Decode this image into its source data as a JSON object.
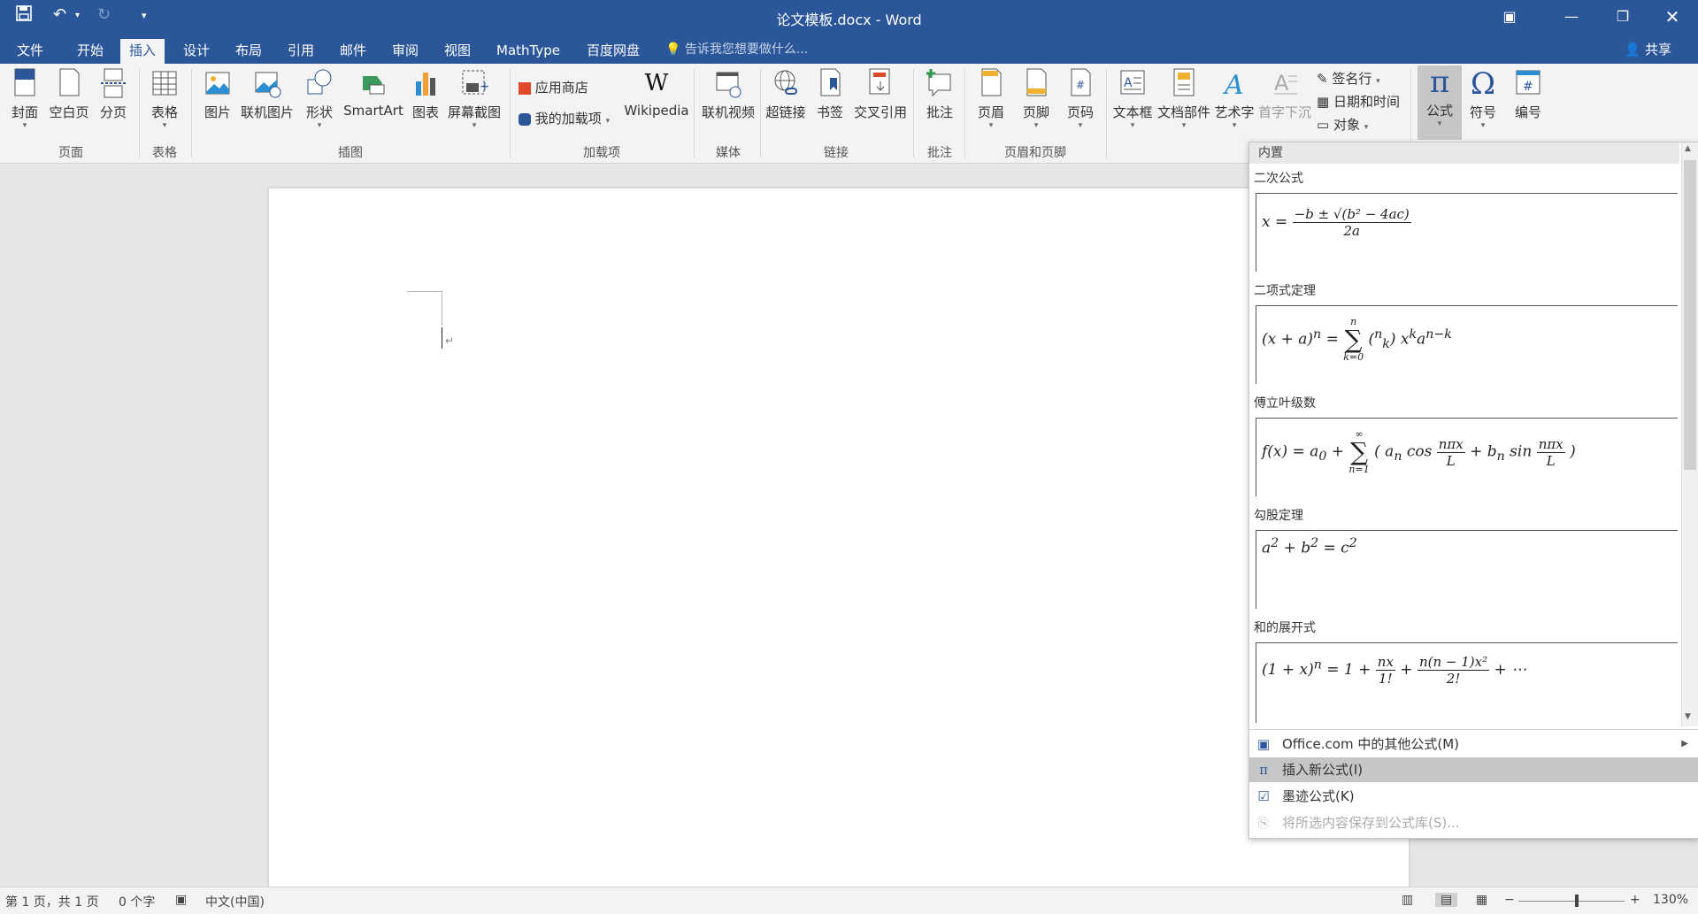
{
  "window": {
    "title": "论文模板.docx - Word",
    "share_label": "共享",
    "tell_me_placeholder": "告诉我您想要做什么..."
  },
  "menu_tabs": [
    "文件",
    "开始",
    "插入",
    "设计",
    "布局",
    "引用",
    "邮件",
    "审阅",
    "视图",
    "MathType",
    "百度网盘"
  ],
  "active_tab": "插入",
  "ribbon": {
    "pages": {
      "cover": "封面",
      "blank": "空白页",
      "break": "分页",
      "group": "页面"
    },
    "tables": {
      "table": "表格",
      "group": "表格"
    },
    "illustrations": {
      "picture": "图片",
      "online_picture": "联机图片",
      "shapes": "形状",
      "smartart": "SmartArt",
      "chart": "图表",
      "screenshot": "屏幕截图",
      "group": "插图"
    },
    "addins": {
      "store": "应用商店",
      "my_addins": "我的加载项",
      "wikipedia": "Wikipedia",
      "wikipedia_icon": "W",
      "group": "加载项"
    },
    "media": {
      "online_video": "联机视频",
      "group": "媒体"
    },
    "links": {
      "hyperlink": "超链接",
      "bookmark": "书签",
      "cross_ref": "交叉引用",
      "group": "链接"
    },
    "comments": {
      "comment": "批注",
      "group": "批注"
    },
    "header_footer": {
      "header": "页眉",
      "footer": "页脚",
      "page_number": "页码",
      "group": "页眉和页脚"
    },
    "text": {
      "textbox": "文本框",
      "quick_parts": "文档部件",
      "wordart": "艺术字",
      "dropcap": "首字下沉",
      "signature": "签名行",
      "datetime": "日期和时间",
      "object": "对象"
    },
    "symbols": {
      "equation": "公式",
      "symbol": "符号",
      "number": "编号",
      "pi_glyph": "π",
      "omega_glyph": "Ω"
    }
  },
  "gallery": {
    "header": "内置",
    "items": [
      {
        "title": "二次公式"
      },
      {
        "title": "二项式定理"
      },
      {
        "title": "傅立叶级数"
      },
      {
        "title": "勾股定理"
      },
      {
        "title": "和的展开式"
      }
    ],
    "commands": [
      {
        "label": "Office.com 中的其他公式(M)",
        "icon": "office-icon",
        "state": "normal"
      },
      {
        "label": "插入新公式(I)",
        "icon": "pi-icon",
        "state": "highlighted"
      },
      {
        "label": "墨迹公式(K)",
        "icon": "ink-equation-icon",
        "state": "normal"
      },
      {
        "label": "将所选内容保存到公式库(S)...",
        "icon": "save-equation-icon",
        "state": "disabled"
      }
    ]
  },
  "status": {
    "page": "第 1 页，共 1 页",
    "words": "0 个字",
    "language": "中文(中国)",
    "zoom": "130%"
  },
  "colors": {
    "brand": "#2b579a",
    "ribbon": "#f3f3f3",
    "highlight": "#c6c6c6"
  }
}
